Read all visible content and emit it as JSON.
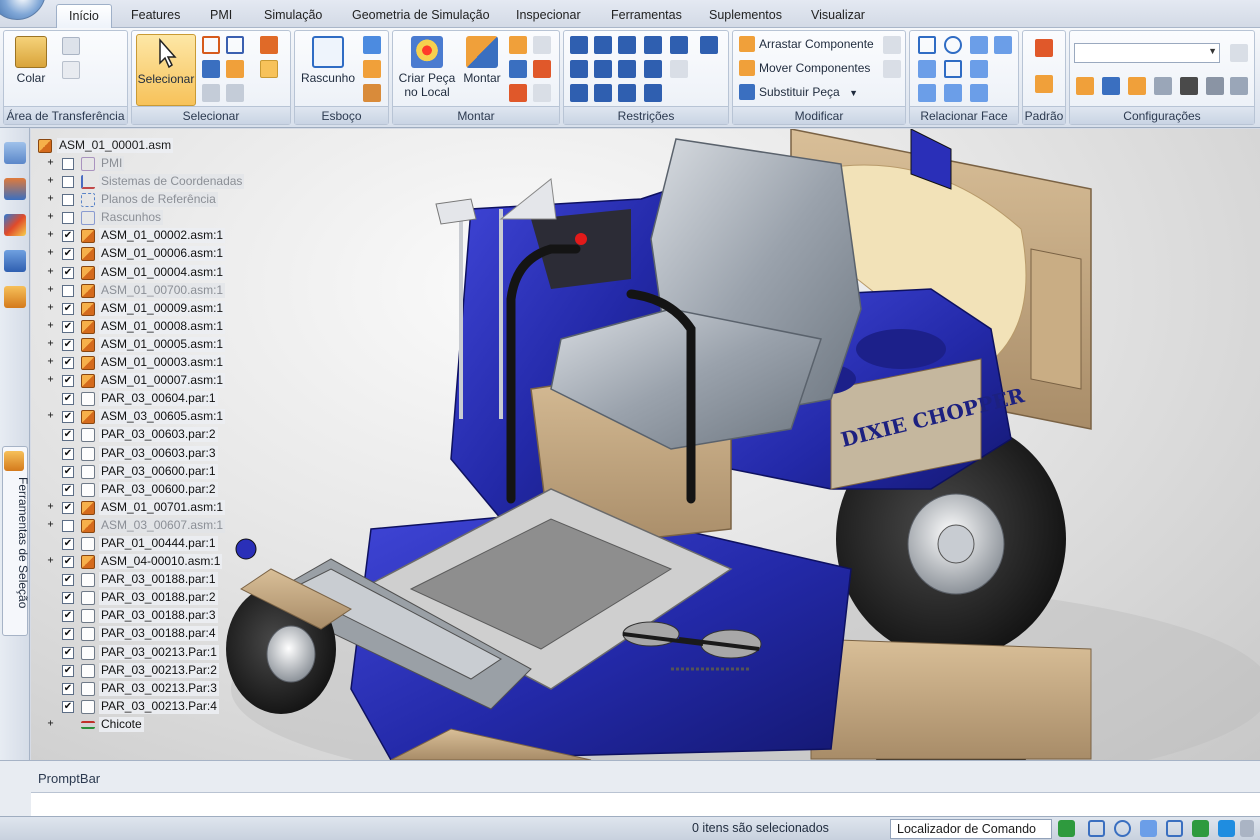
{
  "tabs": [
    "Início",
    "Features",
    "PMI",
    "Simulação",
    "Geometria de Simulação",
    "Inspecionar",
    "Ferramentas",
    "Suplementos",
    "Visualizar"
  ],
  "active_tab": "Início",
  "ribbon": {
    "groups": {
      "clipboard": "Área de Transferência",
      "select": "Selecionar",
      "sketch": "Esboço",
      "assemble": "Montar",
      "constraints": "Restrições",
      "modify": "Modificar",
      "relate_face": "Relacionar Face",
      "pattern": "Padrão",
      "configs": "Configurações"
    },
    "buttons": {
      "paste": "Colar",
      "select": "Selecionar",
      "sketch": "Rascunho",
      "create_in_place": "Criar Peça no Local",
      "assemble": "Montar",
      "drag_component": "Arrastar Componente",
      "move_components": "Mover Componentes",
      "replace_part": "Substituir Peça"
    }
  },
  "sidebar": {
    "tab_label": "Ferramentas de Seleção"
  },
  "tree": {
    "root": "ASM_01_00001.asm",
    "items": [
      {
        "label": "PMI",
        "type": "pmi",
        "checked": false,
        "dim": true,
        "expand": true
      },
      {
        "label": "Sistemas de Coordenadas",
        "type": "cs",
        "checked": false,
        "dim": true,
        "expand": true
      },
      {
        "label": "Planos de Referência",
        "type": "ref",
        "checked": false,
        "dim": true,
        "expand": true
      },
      {
        "label": "Rascunhos",
        "type": "sk",
        "checked": false,
        "dim": true,
        "expand": true
      },
      {
        "label": "ASM_01_00002.asm:1",
        "type": "asm",
        "checked": true,
        "dim": false,
        "expand": true
      },
      {
        "label": "ASM_01_00006.asm:1",
        "type": "asm",
        "checked": true,
        "dim": false,
        "expand": true
      },
      {
        "label": "ASM_01_00004.asm:1",
        "type": "asm",
        "checked": true,
        "dim": false,
        "expand": true
      },
      {
        "label": "ASM_01_00700.asm:1",
        "type": "asm",
        "checked": false,
        "dim": true,
        "expand": true
      },
      {
        "label": "ASM_01_00009.asm:1",
        "type": "asm",
        "checked": true,
        "dim": false,
        "expand": true
      },
      {
        "label": "ASM_01_00008.asm:1",
        "type": "asm",
        "checked": true,
        "dim": false,
        "expand": true
      },
      {
        "label": "ASM_01_00005.asm:1",
        "type": "asm",
        "checked": true,
        "dim": false,
        "expand": true
      },
      {
        "label": "ASM_01_00003.asm:1",
        "type": "asm",
        "checked": true,
        "dim": false,
        "expand": true
      },
      {
        "label": "ASM_01_00007.asm:1",
        "type": "asm",
        "checked": true,
        "dim": false,
        "expand": true
      },
      {
        "label": "PAR_03_00604.par:1",
        "type": "par",
        "checked": true,
        "dim": false,
        "expand": false
      },
      {
        "label": "ASM_03_00605.asm:1",
        "type": "asm",
        "checked": true,
        "dim": false,
        "expand": true
      },
      {
        "label": "PAR_03_00603.par:2",
        "type": "par",
        "checked": true,
        "dim": false,
        "expand": false
      },
      {
        "label": "PAR_03_00603.par:3",
        "type": "par",
        "checked": true,
        "dim": false,
        "expand": false
      },
      {
        "label": "PAR_03_00600.par:1",
        "type": "par",
        "checked": true,
        "dim": false,
        "expand": false
      },
      {
        "label": "PAR_03_00600.par:2",
        "type": "par",
        "checked": true,
        "dim": false,
        "expand": false
      },
      {
        "label": "ASM_01_00701.asm:1",
        "type": "asm",
        "checked": true,
        "dim": false,
        "expand": true
      },
      {
        "label": "ASM_03_00607.asm:1",
        "type": "asm",
        "checked": false,
        "dim": true,
        "expand": true
      },
      {
        "label": "PAR_01_00444.par:1",
        "type": "par",
        "checked": true,
        "dim": false,
        "expand": false
      },
      {
        "label": "ASM_04-00010.asm:1",
        "type": "asm",
        "checked": true,
        "dim": false,
        "expand": true
      },
      {
        "label": "PAR_03_00188.par:1",
        "type": "par",
        "checked": true,
        "dim": false,
        "expand": false
      },
      {
        "label": "PAR_03_00188.par:2",
        "type": "par",
        "checked": true,
        "dim": false,
        "expand": false
      },
      {
        "label": "PAR_03_00188.par:3",
        "type": "par",
        "checked": true,
        "dim": false,
        "expand": false
      },
      {
        "label": "PAR_03_00188.par:4",
        "type": "par",
        "checked": true,
        "dim": false,
        "expand": false
      },
      {
        "label": "PAR_03_00213.Par:1",
        "type": "par",
        "checked": true,
        "dim": false,
        "expand": false
      },
      {
        "label": "PAR_03_00213.Par:2",
        "type": "par",
        "checked": true,
        "dim": false,
        "expand": false
      },
      {
        "label": "PAR_03_00213.Par:3",
        "type": "par",
        "checked": true,
        "dim": false,
        "expand": false
      },
      {
        "label": "PAR_03_00213.Par:4",
        "type": "par",
        "checked": true,
        "dim": false,
        "expand": false
      },
      {
        "label": "Chicote",
        "type": "wire",
        "checked": null,
        "dim": false,
        "expand": true
      }
    ]
  },
  "model": {
    "decal_text": "DIXIE CHOPPER"
  },
  "promptbar": {
    "title": "PromptBar",
    "value": ""
  },
  "status": {
    "selection": "0 itens são selecionados",
    "command_finder": "Localizador de Comando"
  },
  "colors": {
    "model_blue": "#2a2fb8",
    "accent": "#f7c25a"
  }
}
